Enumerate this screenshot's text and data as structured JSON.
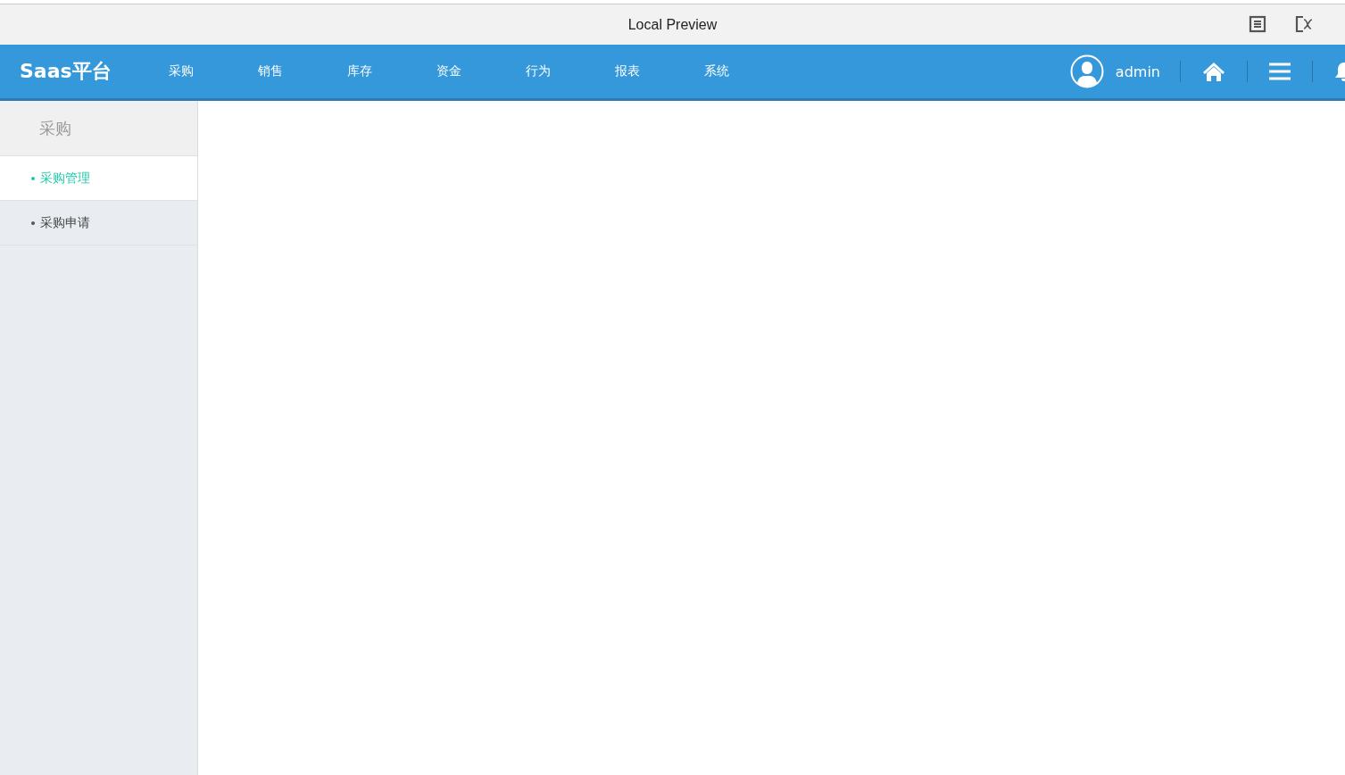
{
  "window": {
    "title": "Local Preview"
  },
  "header": {
    "logo": "Saas平台",
    "nav": [
      {
        "label": "采购"
      },
      {
        "label": "销售"
      },
      {
        "label": "库存"
      },
      {
        "label": "资金"
      },
      {
        "label": "行为"
      },
      {
        "label": "报表"
      },
      {
        "label": "系统"
      }
    ],
    "user": "admin"
  },
  "sidebar": {
    "title": "采购",
    "items": [
      {
        "label": "采购管理",
        "selected": true
      },
      {
        "label": "采购申请",
        "selected": false
      }
    ]
  }
}
